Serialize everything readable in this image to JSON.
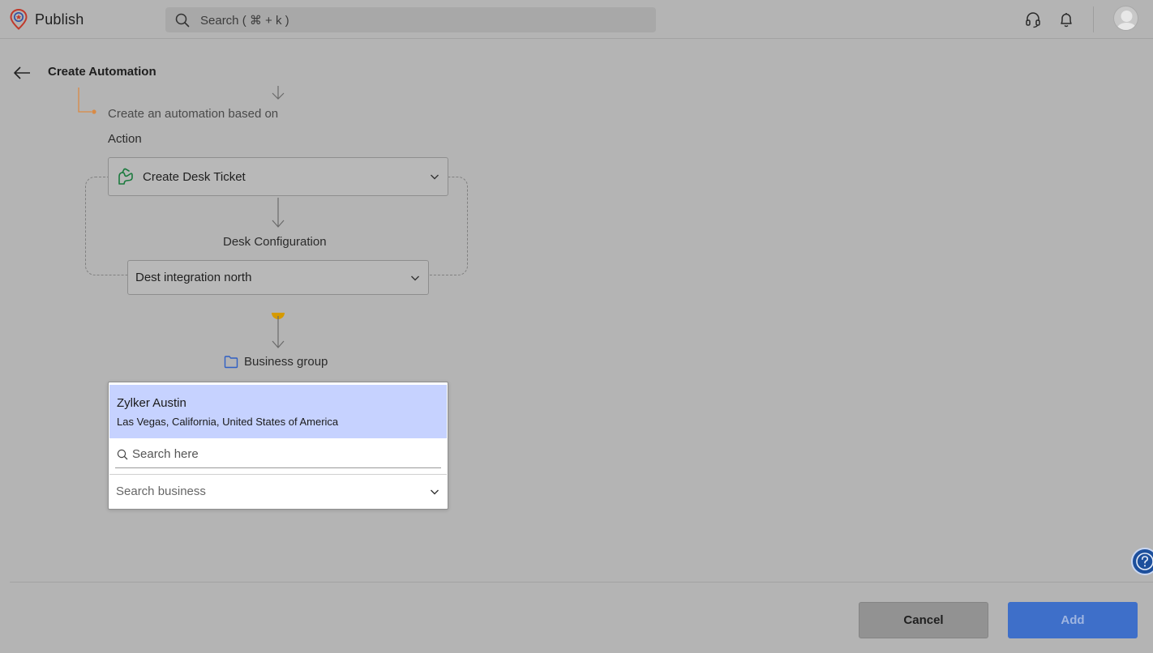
{
  "app": {
    "name": "Publish",
    "search_placeholder": "Search ( ⌘ + k )",
    "icons": [
      "logo-icon",
      "search-icon",
      "headset-icon",
      "bell-icon",
      "avatar-icon"
    ]
  },
  "header": {
    "title": "Create Automation"
  },
  "flow": {
    "based_on_label": "Create an automation based on",
    "action_label": "Action",
    "action_value": "Create Desk Ticket",
    "desk_config_label": "Desk Configuration",
    "desk_config_value": "Dest integration north",
    "business_group_label": "Business group"
  },
  "dropdown": {
    "selected_option": {
      "name": "Zylker Austin",
      "location": "Las Vegas, California, United States of America"
    },
    "search_placeholder": "Search here",
    "select_placeholder": "Search business"
  },
  "footer": {
    "cancel_label": "Cancel",
    "add_label": "Add"
  },
  "colors": {
    "background": "#b4b4b4",
    "accent": "#3e6fc9",
    "highlight": "#c6d2ff",
    "connector_orange": "#d98a45",
    "connector_dot": "#d69a00",
    "desk_icon_green": "#1b7a3e",
    "folder_icon_blue": "#2f5fc4"
  }
}
